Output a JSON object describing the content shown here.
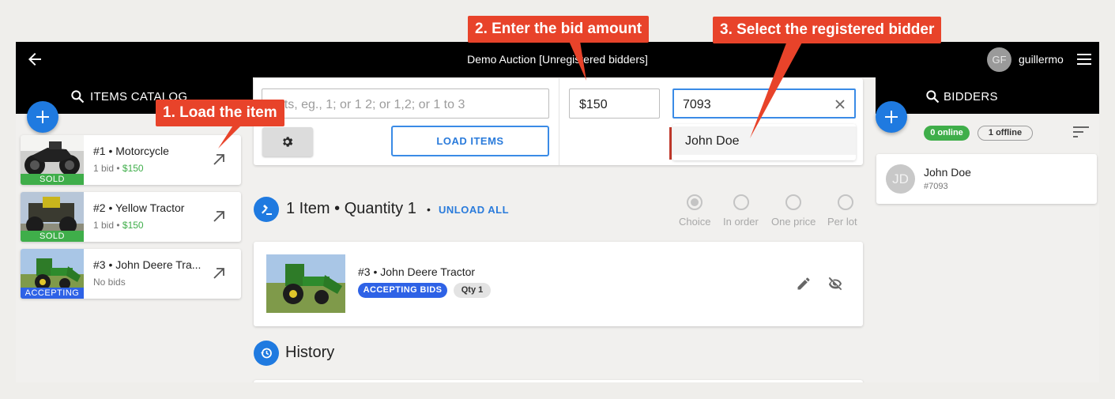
{
  "header": {
    "title": "Demo Auction [Unregistered bidders]",
    "avatar_initials": "GF",
    "username": "guillermo"
  },
  "items_panel": {
    "heading": "ITEMS CATALOG",
    "items": [
      {
        "title": "#1 • Motorcycle",
        "bids": "1 bid •",
        "price": "$150",
        "badge": "SOLD"
      },
      {
        "title": "#2 • Yellow Tractor",
        "bids": "1 bid •",
        "price": "$150",
        "badge": "SOLD"
      },
      {
        "title": "#3 • John Deere Tra...",
        "bids": "No bids",
        "price": "",
        "badge": "ACCEPTING"
      }
    ]
  },
  "lot_entry": {
    "placeholder": "Lots, eg., 1; or 1 2; or 1,2; or 1 to 3",
    "load_label": "LOAD ITEMS",
    "bid_amount": "$150",
    "bidder_query": "7093",
    "suggestion": "John Doe"
  },
  "loaded": {
    "summary": "1 Item • Quantity 1",
    "separator": "•",
    "unload_label": "UNLOAD ALL",
    "modes": [
      "Choice",
      "In order",
      "One price",
      "Per lot"
    ],
    "selected_mode": "Choice",
    "item_title": "#3 • John Deere Tractor",
    "status": "ACCEPTING BIDS",
    "qty": "Qty 1"
  },
  "history": {
    "heading": "History"
  },
  "bidders_panel": {
    "heading": "BIDDERS",
    "online": "0 online",
    "offline": "1 offline",
    "bidder_initials": "JD",
    "bidder_name": "John Doe",
    "bidder_number": "#7093"
  },
  "callouts": {
    "step1": "1. Load the item",
    "step2": "2. Enter the bid amount",
    "step3": "3. Select the registered bidder"
  },
  "colors": {
    "accent": "#1f7ae0",
    "sold": "#3fae4a",
    "accepting": "#2e62e6",
    "callout": "#e8432a"
  }
}
